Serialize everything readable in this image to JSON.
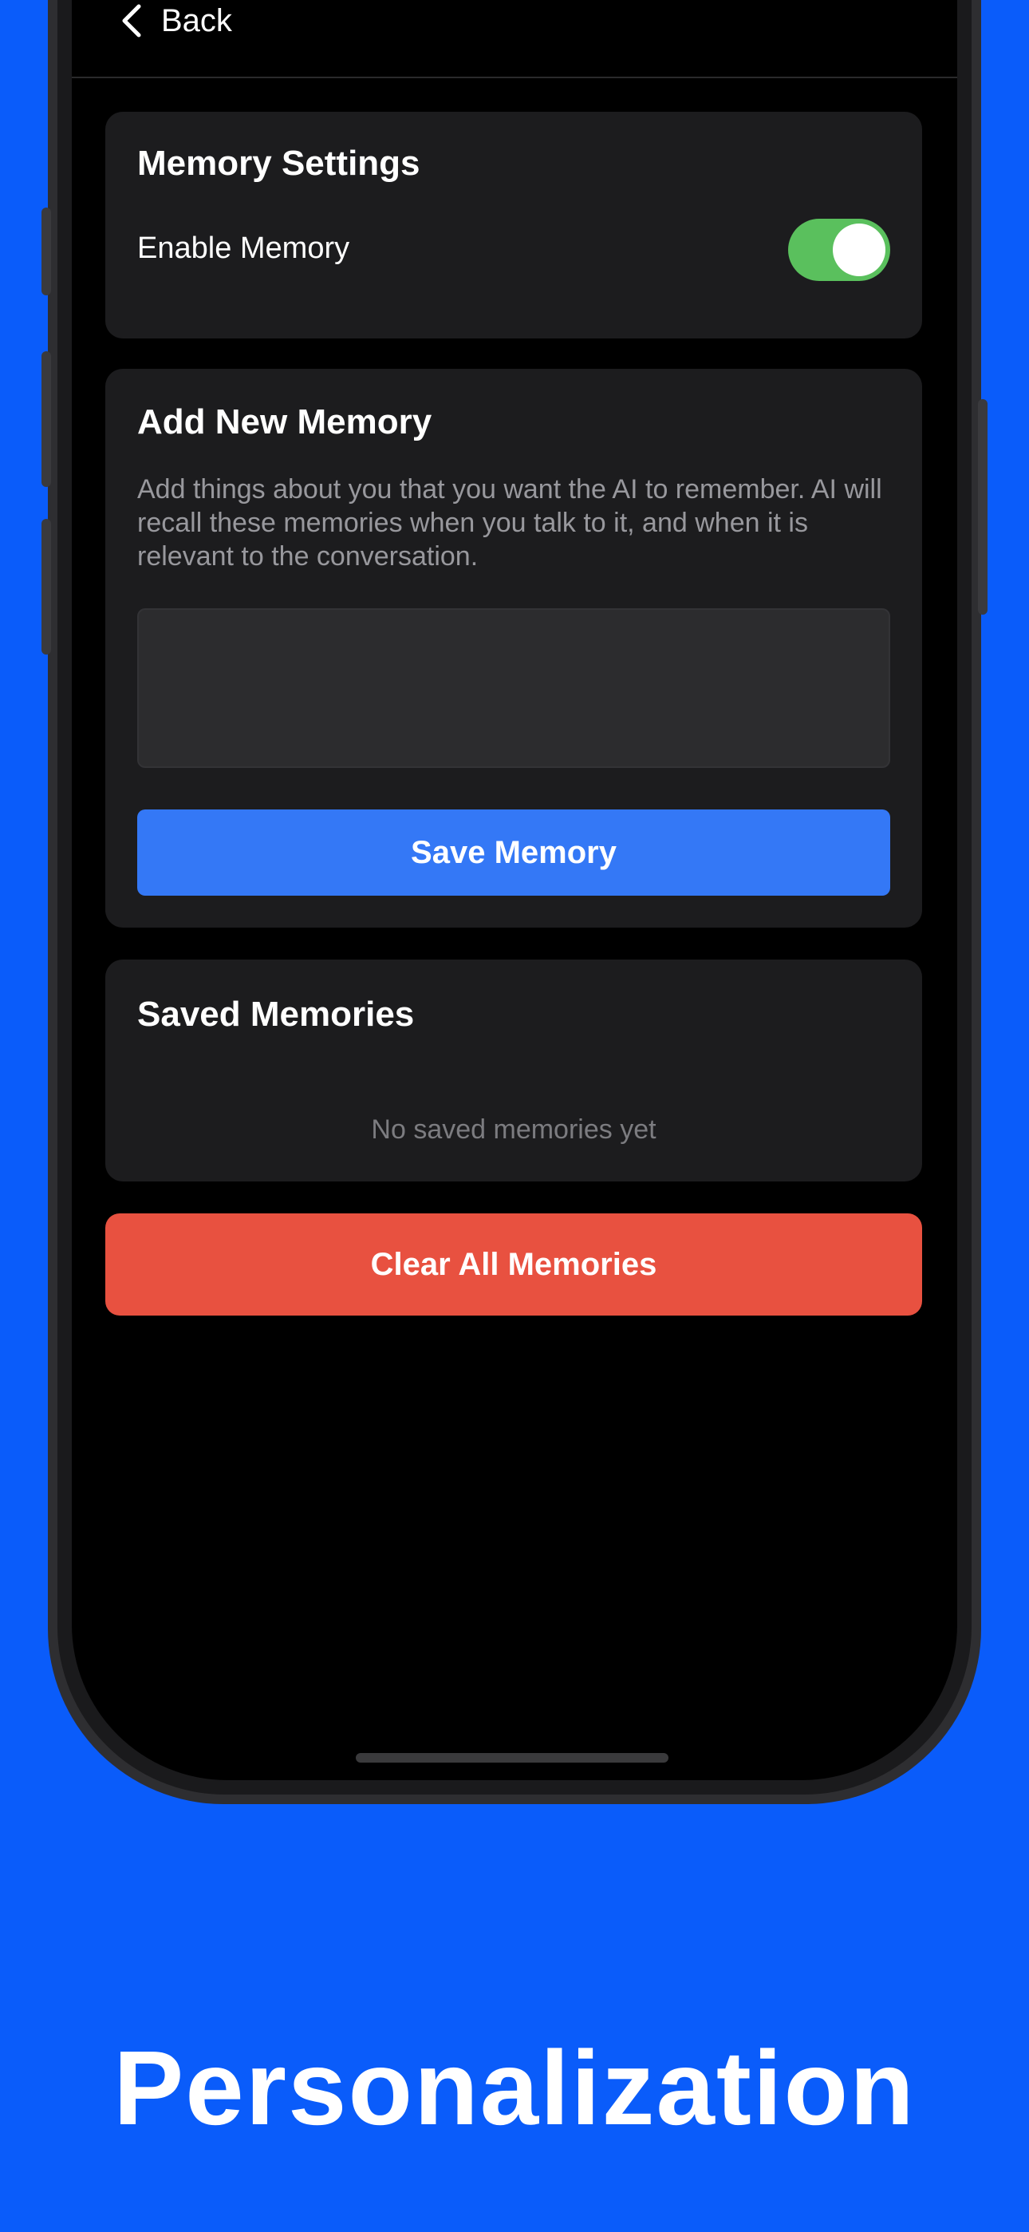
{
  "nav": {
    "back_label": "Back"
  },
  "memory_settings": {
    "title": "Memory Settings",
    "enable_label": "Enable Memory",
    "enabled": true
  },
  "add_memory": {
    "title": "Add New Memory",
    "description": "Add things about you that you want the AI to remember. AI will recall these memories when you talk to it, and when it is relevant to the conversation.",
    "input_value": "",
    "save_label": "Save Memory"
  },
  "saved_memories": {
    "title": "Saved Memories",
    "empty_text": "No saved memories yet"
  },
  "clear_label": "Clear All Memories",
  "tagline": "Personalization",
  "colors": {
    "background": "#0a5cfa",
    "toggle_on": "#5ac05d",
    "save_button": "#3478f6",
    "clear_button": "#e85140"
  },
  "icons": {
    "back": "chevron-left-icon"
  }
}
